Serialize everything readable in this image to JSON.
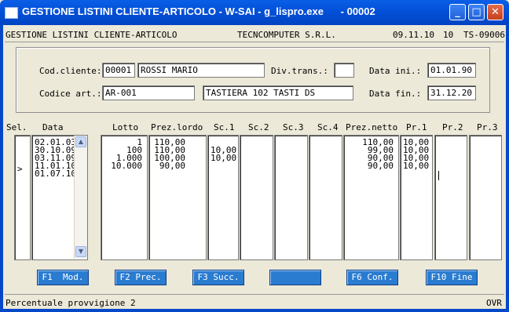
{
  "window": {
    "title": "GESTIONE LISTINI CLIENTE-ARTICOLO - W-SAI - g_lispro.exe      - 00002",
    "buttons": {
      "minimize": "minimize-icon",
      "maximize": "maximize-icon",
      "close": "close-icon"
    }
  },
  "header": {
    "program": "GESTIONE LISTINI CLIENTE-ARTICOLO",
    "company": "TECNCOMPUTER S.R.L.",
    "date": "09.11.10",
    "terminal": "10",
    "code": "TS-09006"
  },
  "form": {
    "cod_cliente_label": "Cod.cliente:",
    "cod_cliente": "00001",
    "cliente_name": "ROSSI MARIO",
    "div_trans_label": "Div.trans.:",
    "div_trans": "",
    "data_ini_label": "Data ini.:",
    "data_ini": "01.01.90",
    "codice_art_label": "Codice art.:",
    "codice_art": "AR-001",
    "art_desc": "TASTIERA 102 TASTI DS",
    "data_fin_label": "Data fin.:",
    "data_fin": "31.12.20"
  },
  "grid": {
    "headers": [
      "Sel.",
      "Data",
      "Lotto",
      "Prez.lordo",
      "Sc.1",
      "Sc.2",
      "Sc.3",
      "Sc.4",
      "Prez.netto",
      "Pr.1",
      "Pr.2",
      "Pr.3"
    ],
    "sel": [
      "",
      "",
      "",
      ">",
      ""
    ],
    "data": [
      "02.01.03",
      "30.10.09",
      "03.11.09",
      "11.01.10",
      "01.07.10"
    ],
    "lotto": [
      "1",
      "100",
      "1.000",
      "10.000"
    ],
    "prez_lordo": [
      "110,00",
      "110,00",
      "100,00",
      "90,00"
    ],
    "sc1": [
      "",
      "10,00",
      "10,00",
      ""
    ],
    "prez_netto": [
      "110,00",
      "99,00",
      "90,00",
      "90,00"
    ],
    "pr1": [
      "10,00",
      "10,00",
      "10,00",
      "10,00"
    ]
  },
  "fkeys": {
    "f1": "F1  Mod.",
    "f2": "F2 Prec.",
    "f3": "F3 Succ.",
    "f4": "",
    "f6": "F6 Conf.",
    "f10": "F10 Fine"
  },
  "status": {
    "message": "Percentuale provvigione 2",
    "mode": "OVR"
  },
  "colors": {
    "titlebar": "#0350d8",
    "fkey": "#2a7cd0",
    "background": "#ece9d8"
  }
}
